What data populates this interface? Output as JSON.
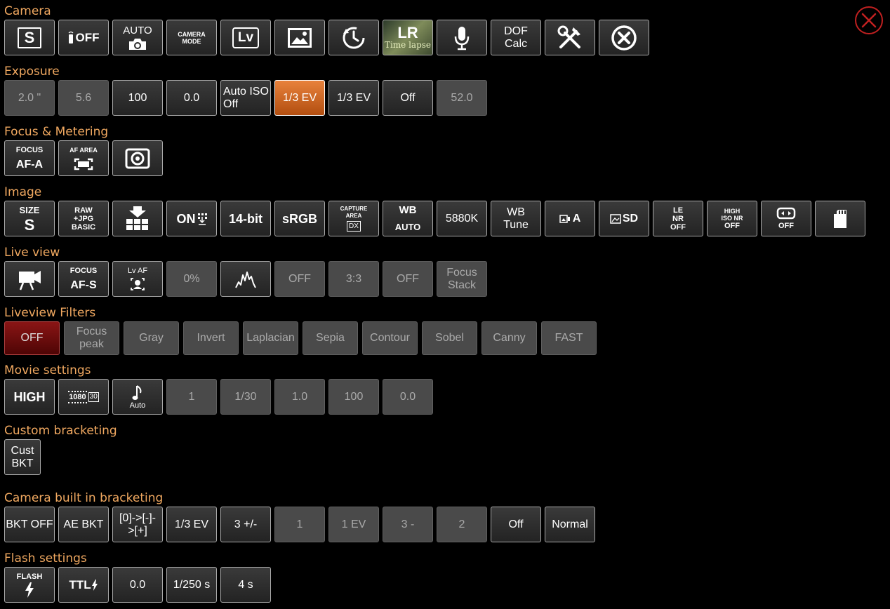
{
  "sections": {
    "camera": "Camera",
    "exposure": "Exposure",
    "focus_metering": "Focus & Metering",
    "image": "Image",
    "live_view": "Live view",
    "liveview_filters": "Liveview Filters",
    "movie_settings": "Movie settings",
    "custom_bracketing": "Custom bracketing",
    "camera_bracketing": "Camera built in bracketing",
    "flash_settings": "Flash settings"
  },
  "camera": {
    "mode_letter": "S",
    "timer_label": "OFF",
    "auto_label": "AUTO",
    "camera_mode_line1": "CAMERA",
    "camera_mode_line2": "MODE",
    "lv_label": "Lv",
    "timelapse_lr": "LR",
    "timelapse_word": "Time lapse",
    "dof_line1": "DOF",
    "dof_line2": "Calc",
    "icons": [
      "mode-icon",
      "remote-icon",
      "auto-camera-icon",
      "camera-mode-icon",
      "liveview-icon",
      "gallery-icon",
      "timer-icon",
      "timelapse-icon",
      "microphone-icon",
      "dof-calc-icon",
      "tools-icon",
      "close-circle-icon"
    ]
  },
  "exposure": {
    "shutter": "2.0 \"",
    "aperture": "5.6",
    "iso": "100",
    "ev_comp": "0.0",
    "auto_iso_line1": "Auto ISO",
    "auto_iso_line2": "Off",
    "ev_step_1": "1/3 EV",
    "ev_step_2": "1/3 EV",
    "flicker": "Off",
    "fps": "52.0"
  },
  "focus": {
    "focus_label": "FOCUS",
    "focus_value": "AF-A",
    "af_area_label": "AF AREA"
  },
  "image": {
    "size_label": "SIZE",
    "size_value": "S",
    "raw_line1": "RAW",
    "raw_line2": "+JPG",
    "raw_line3": "BASIC",
    "on_label": "ON",
    "bit_depth": "14-bit",
    "color_space": "sRGB",
    "capture_line1": "CAPTURE",
    "capture_line2": "AREA",
    "capture_value": "DX",
    "wb_label": "WB",
    "wb_value": "AUTO",
    "wb_kelvin": "5880K",
    "wb_tune_line1": "WB",
    "wb_tune_line2": "Tune",
    "picture_control": "A",
    "active_dlighting": "SD",
    "le_line1": "LE",
    "le_line2": "NR",
    "le_line3": "OFF",
    "hi_line1": "HIGH",
    "hi_line2": "ISO NR",
    "hi_line3": "OFF",
    "vignette_value": "OFF"
  },
  "liveview": {
    "focus_label": "FOCUS",
    "focus_value": "AF-S",
    "lvaf_label": "Lv AF",
    "zoom": "0%",
    "grid": "OFF",
    "aspect": "3:3",
    "overlay": "OFF",
    "stack_line1": "Focus",
    "stack_line2": "Stack"
  },
  "filters": [
    "OFF",
    "Focus peak",
    "Gray",
    "Invert",
    "Laplacian",
    "Sepia",
    "Contour",
    "Sobel",
    "Canny",
    "FAST"
  ],
  "movie": {
    "quality": "HIGH",
    "res_line1": "1080",
    "res_fps": "30",
    "sound_label": "Auto",
    "value1": "1",
    "shutter": "1/30",
    "aperture": "1.0",
    "iso": "100",
    "ev": "0.0"
  },
  "custom_bkt": {
    "line1": "Cust",
    "line2": "BKT"
  },
  "bracketing": {
    "bkt": "BKT OFF",
    "ae": "AE BKT",
    "order_line1": "[0]->[-]-",
    "order_line2": ">[+]",
    "step": "1/3 EV",
    "count": "3 +/-",
    "disabled": [
      "1",
      "1 EV",
      "3 -",
      "2"
    ],
    "off": "Off",
    "normal": "Normal"
  },
  "flash": {
    "flash_label": "FLASH",
    "ttl": "TTL",
    "comp": "0.0",
    "sync": "1/250 s",
    "time": "4 s"
  }
}
